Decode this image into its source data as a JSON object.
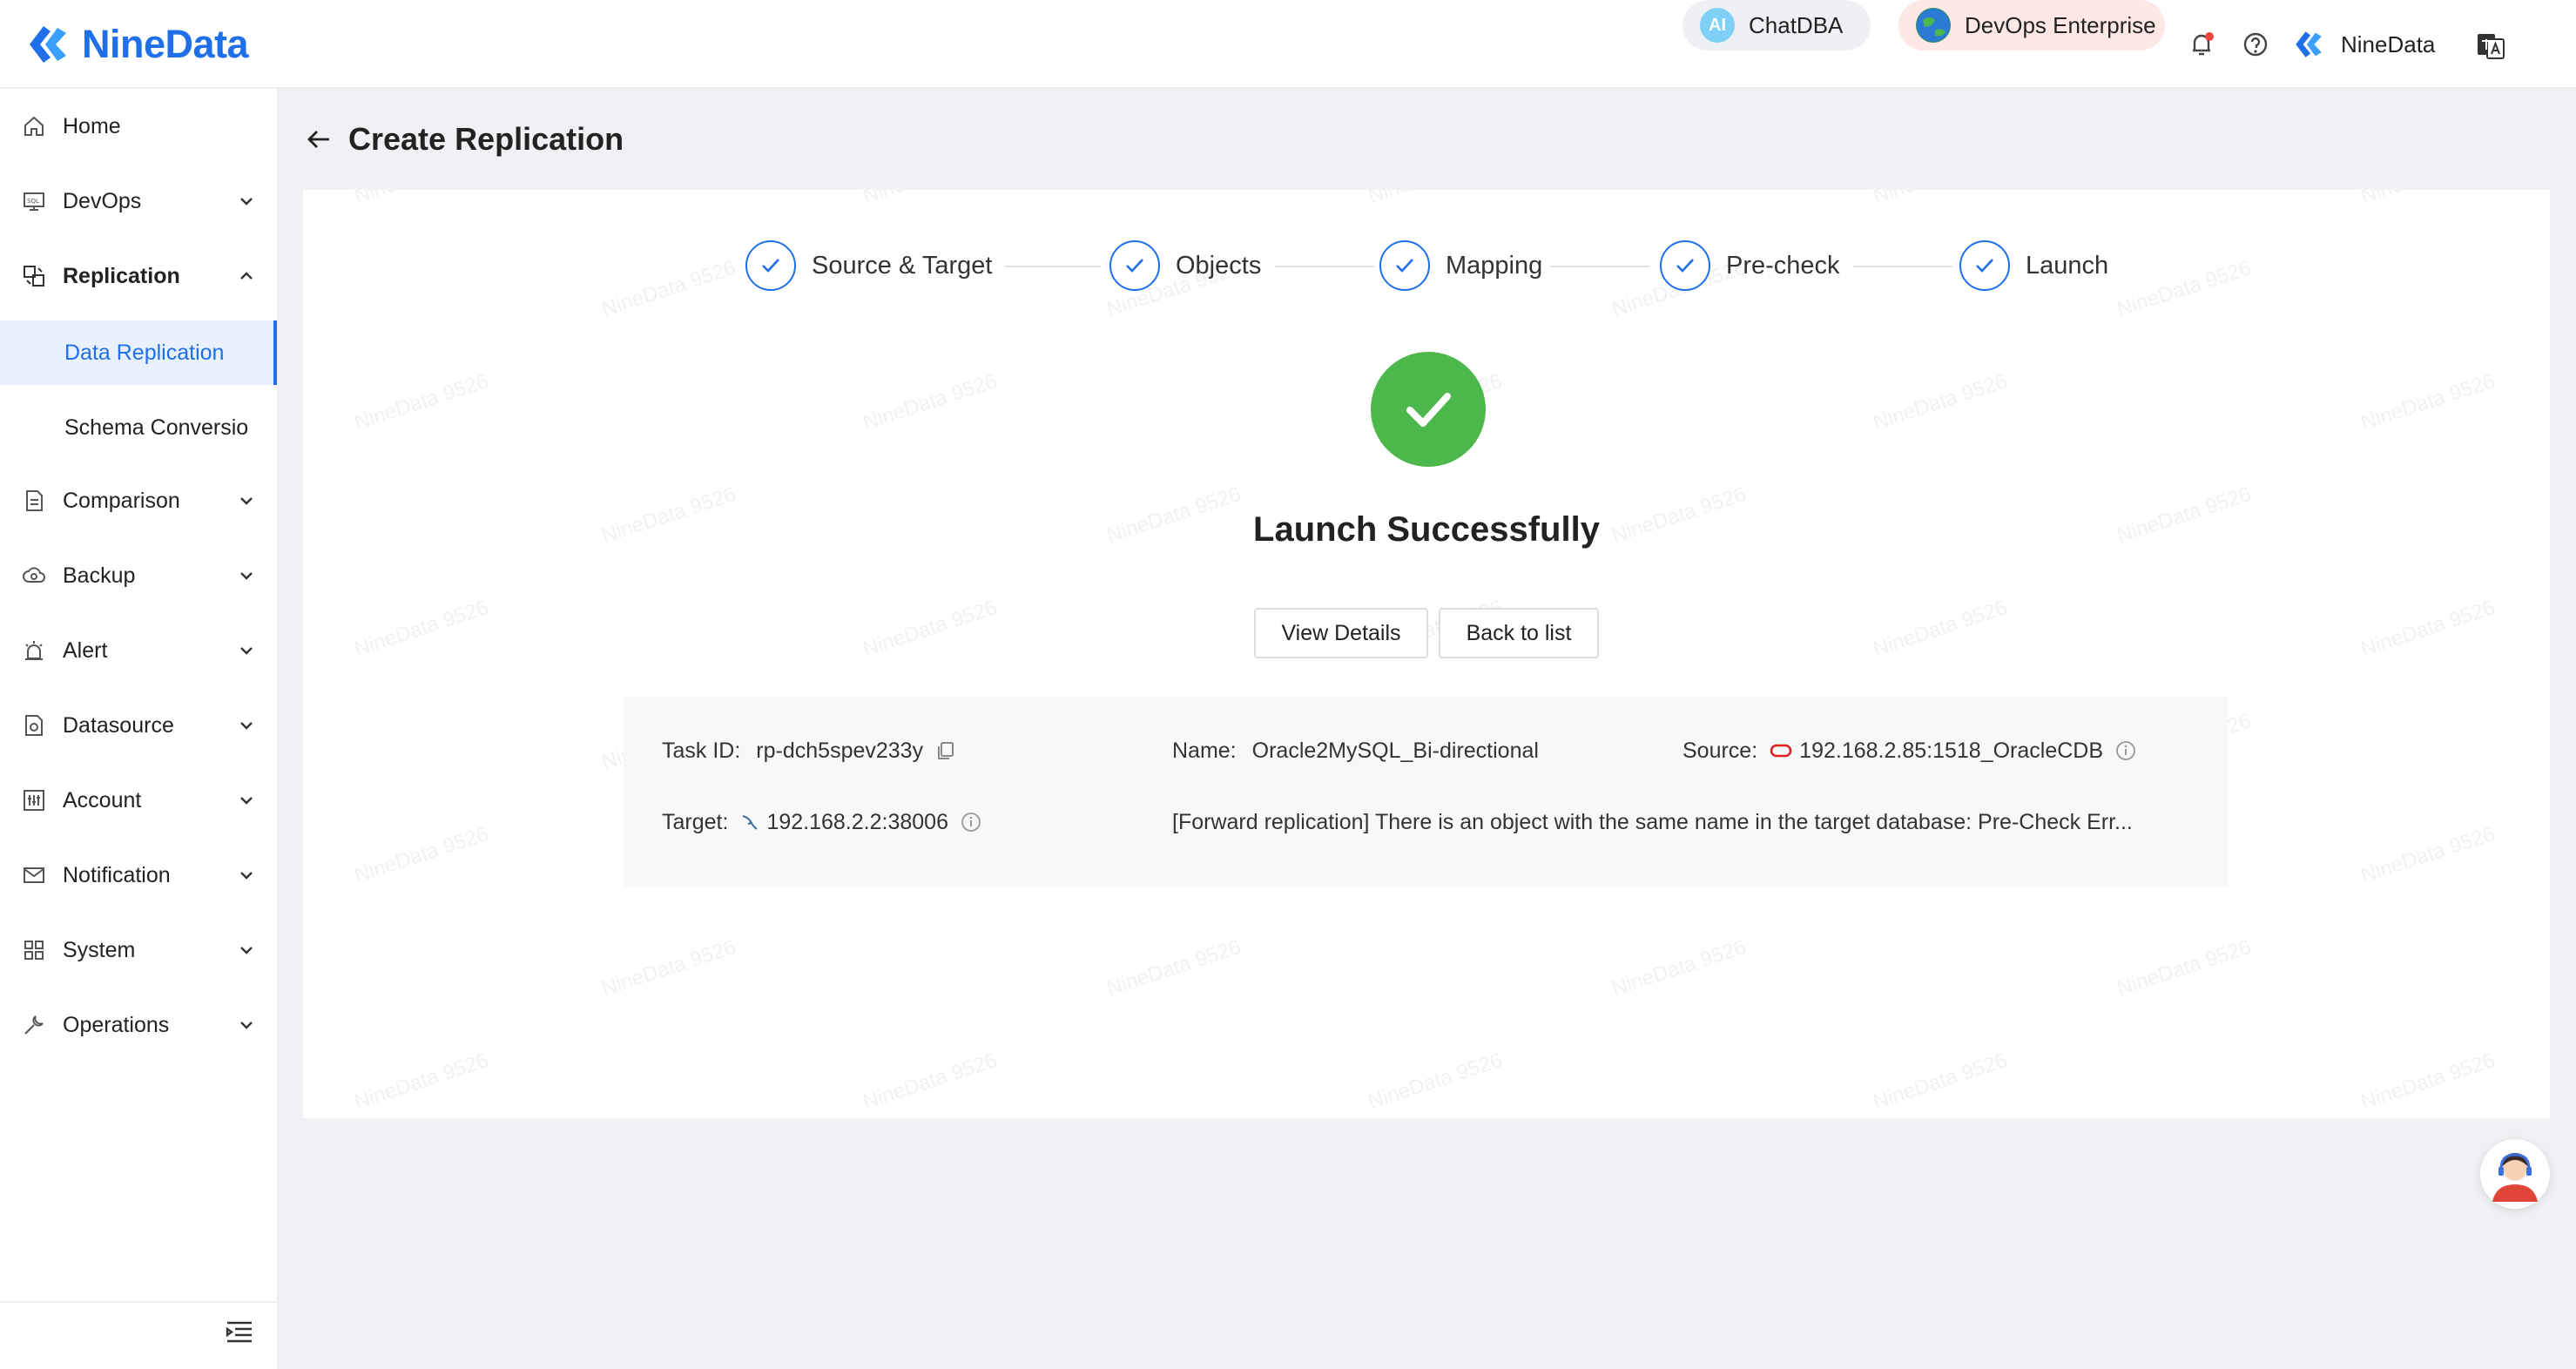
{
  "header": {
    "brand": "NineData",
    "chatdba_label": "ChatDBA",
    "devops_label": "DevOps Enterprise",
    "user_name": "NineData"
  },
  "sidebar": {
    "items": [
      {
        "label": "Home"
      },
      {
        "label": "DevOps"
      },
      {
        "label": "Replication"
      },
      {
        "label": "Comparison"
      },
      {
        "label": "Backup"
      },
      {
        "label": "Alert"
      },
      {
        "label": "Datasource"
      },
      {
        "label": "Account"
      },
      {
        "label": "Notification"
      },
      {
        "label": "System"
      },
      {
        "label": "Operations"
      }
    ],
    "sub_items": [
      {
        "label": "Data Replication",
        "active": true
      },
      {
        "label": "Schema Conversio"
      }
    ]
  },
  "page": {
    "title": "Create Replication"
  },
  "steps": [
    {
      "label": "Source & Target"
    },
    {
      "label": "Objects"
    },
    {
      "label": "Mapping"
    },
    {
      "label": "Pre-check"
    },
    {
      "label": "Launch"
    }
  ],
  "result": {
    "title": "Launch Successfully",
    "view_details": "View Details",
    "back_to_list": "Back to list"
  },
  "info": {
    "task_id_label": "Task ID:",
    "task_id": "rp-dch5spev233y",
    "name_label": "Name:",
    "name": "Oracle2MySQL_Bi-directional",
    "source_label": "Source:",
    "source": "192.168.2.85:1518_OracleCDB",
    "target_label": "Target:",
    "target": "192.168.2.2:38006",
    "message": "[Forward replication] There is an object with the same name in the target database: Pre-Check Err..."
  },
  "watermark_text": "NineData 9526",
  "colors": {
    "accent": "#1f6fe8",
    "success": "#4cb74a",
    "oracle": "#e02020"
  }
}
